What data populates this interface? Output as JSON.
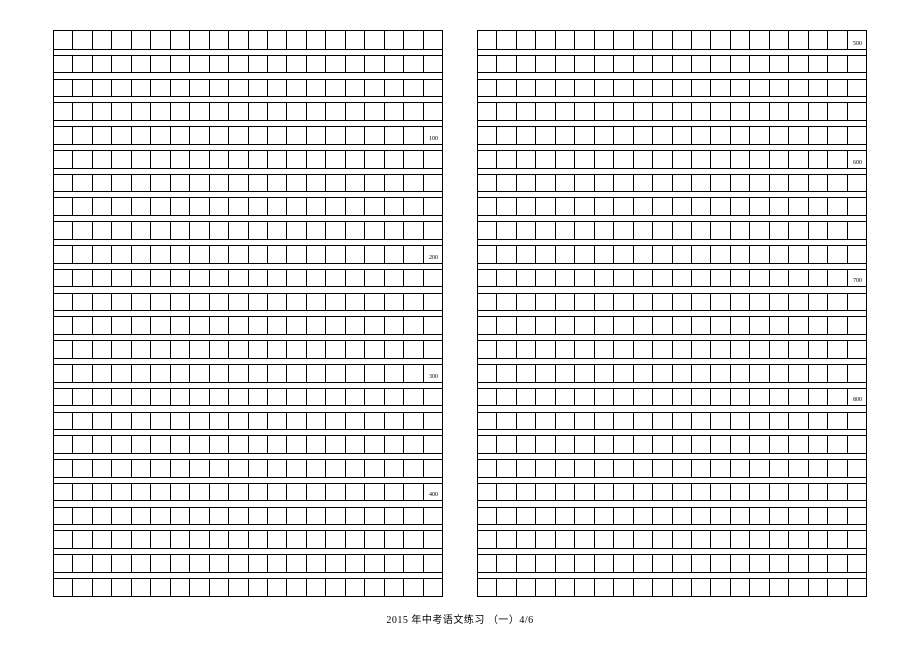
{
  "grid": {
    "columns_per_row": 20,
    "text_rows_per_block": 24,
    "blocks": 2
  },
  "count_markers": {
    "left": [
      {
        "row_index": 5,
        "label": "100"
      },
      {
        "row_index": 10,
        "label": "200"
      },
      {
        "row_index": 15,
        "label": "300"
      },
      {
        "row_index": 20,
        "label": "400"
      }
    ],
    "right": [
      {
        "row_index": 1,
        "label": "500"
      },
      {
        "row_index": 6,
        "label": "600"
      },
      {
        "row_index": 11,
        "label": "700"
      },
      {
        "row_index": 16,
        "label": "800"
      }
    ]
  },
  "footer_text": "2015 年中考语文练习 （一）4/6"
}
